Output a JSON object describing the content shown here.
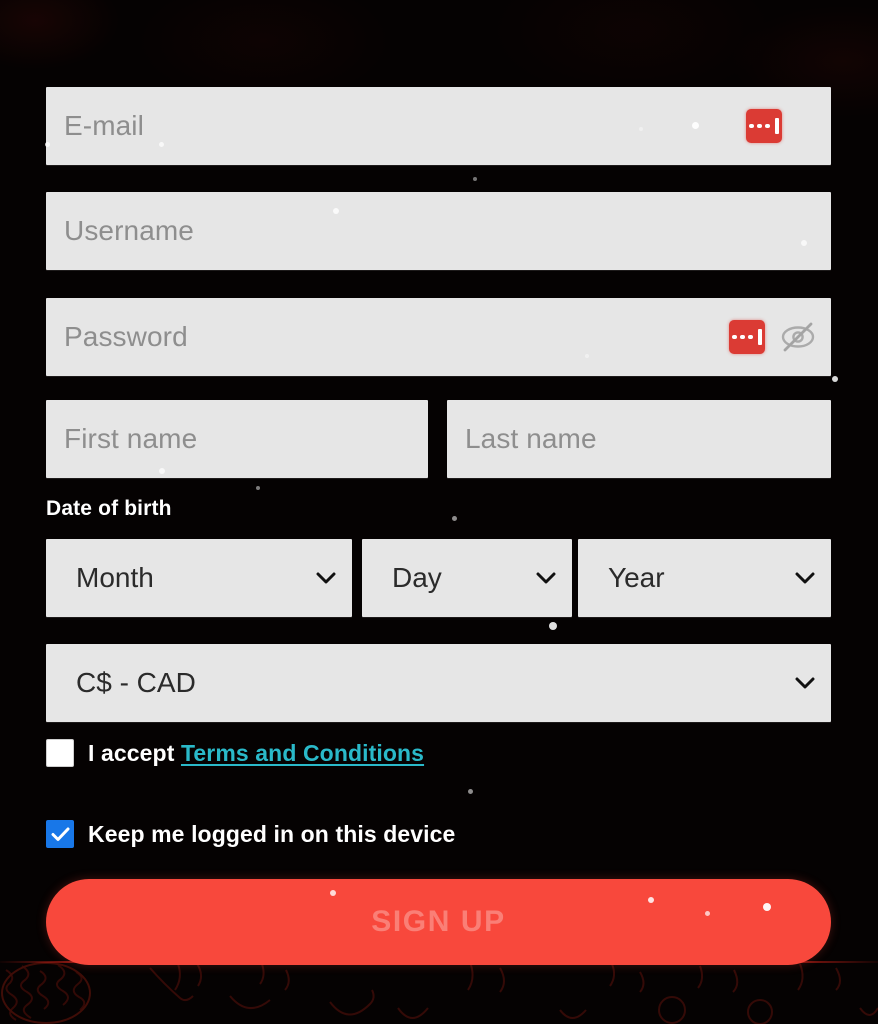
{
  "theme": {
    "background": "#050202",
    "field_bg": "#e6e6e6",
    "placeholder_color": "#8e8e8e",
    "value_color": "#2b2b2b",
    "label_color": "#ffffff",
    "link_color": "#2ab9c9",
    "checkbox_checked_color": "#1877e8",
    "accent_button_color": "#f8483c",
    "password_manager_icon_color": "#db3b34",
    "rule_color": "#d6241a"
  },
  "form": {
    "email": {
      "placeholder": "E-mail",
      "value": "",
      "password_manager_icon": "password-manager-icon"
    },
    "username": {
      "placeholder": "Username",
      "value": ""
    },
    "password": {
      "placeholder": "Password",
      "value": "",
      "password_manager_icon": "password-manager-icon",
      "visibility_icon": "eye-off-icon"
    },
    "first_name": {
      "placeholder": "First name",
      "value": ""
    },
    "last_name": {
      "placeholder": "Last name",
      "value": ""
    },
    "date_of_birth": {
      "label": "Date of birth",
      "month": {
        "selected": "Month",
        "chevron": "chevron-down-icon"
      },
      "day": {
        "selected": "Day",
        "chevron": "chevron-down-icon"
      },
      "year": {
        "selected": "Year",
        "chevron": "chevron-down-icon"
      }
    },
    "currency": {
      "selected": "C$ - CAD",
      "chevron": "chevron-down-icon"
    },
    "terms": {
      "checked": false,
      "prefix_text": "I accept",
      "link_text": "Terms and Conditions"
    },
    "keep_logged_in": {
      "checked": true,
      "label": "Keep me logged in on this device"
    },
    "submit": {
      "label": "SIGN UP",
      "enabled": false
    }
  }
}
